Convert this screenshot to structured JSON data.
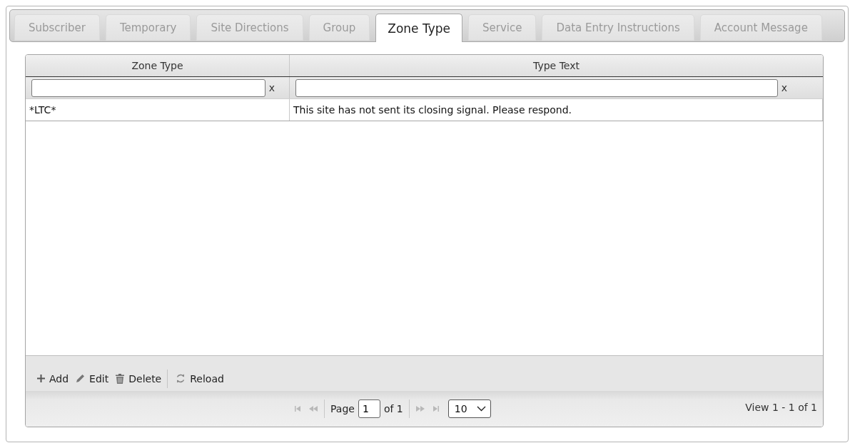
{
  "tabs": [
    {
      "label": "Subscriber",
      "selected": false
    },
    {
      "label": "Temporary",
      "selected": false
    },
    {
      "label": "Site Directions",
      "selected": false
    },
    {
      "label": "Group",
      "selected": false
    },
    {
      "label": "Zone Type",
      "selected": true
    },
    {
      "label": "Service",
      "selected": false
    },
    {
      "label": "Data Entry Instructions",
      "selected": false
    },
    {
      "label": "Account Message",
      "selected": false
    }
  ],
  "grid": {
    "columns": [
      {
        "label": "Zone Type"
      },
      {
        "label": "Type Text"
      }
    ],
    "filters": [
      {
        "clear": "x"
      },
      {
        "clear": "x"
      }
    ],
    "rows": [
      {
        "cells": [
          "*LTC*",
          "This site has not sent its closing signal. Please respond."
        ]
      }
    ],
    "toolbar": {
      "groups": [
        [
          {
            "kind": "add",
            "label": "Add"
          },
          {
            "kind": "edit",
            "label": "Edit"
          },
          {
            "kind": "delete",
            "label": "Delete"
          }
        ],
        [
          {
            "kind": "reload",
            "label": "Reload"
          }
        ]
      ]
    },
    "pager": {
      "back": [
        {
          "kind": "first",
          "disabled": true
        },
        {
          "kind": "prev",
          "disabled": true
        }
      ],
      "page_label": "Page",
      "page": "1",
      "page_total": "of 1",
      "forward": [
        {
          "kind": "next",
          "disabled": true
        },
        {
          "kind": "last",
          "disabled": true
        }
      ],
      "page_size": "10",
      "summary": "View 1 - 1 of 1"
    }
  }
}
